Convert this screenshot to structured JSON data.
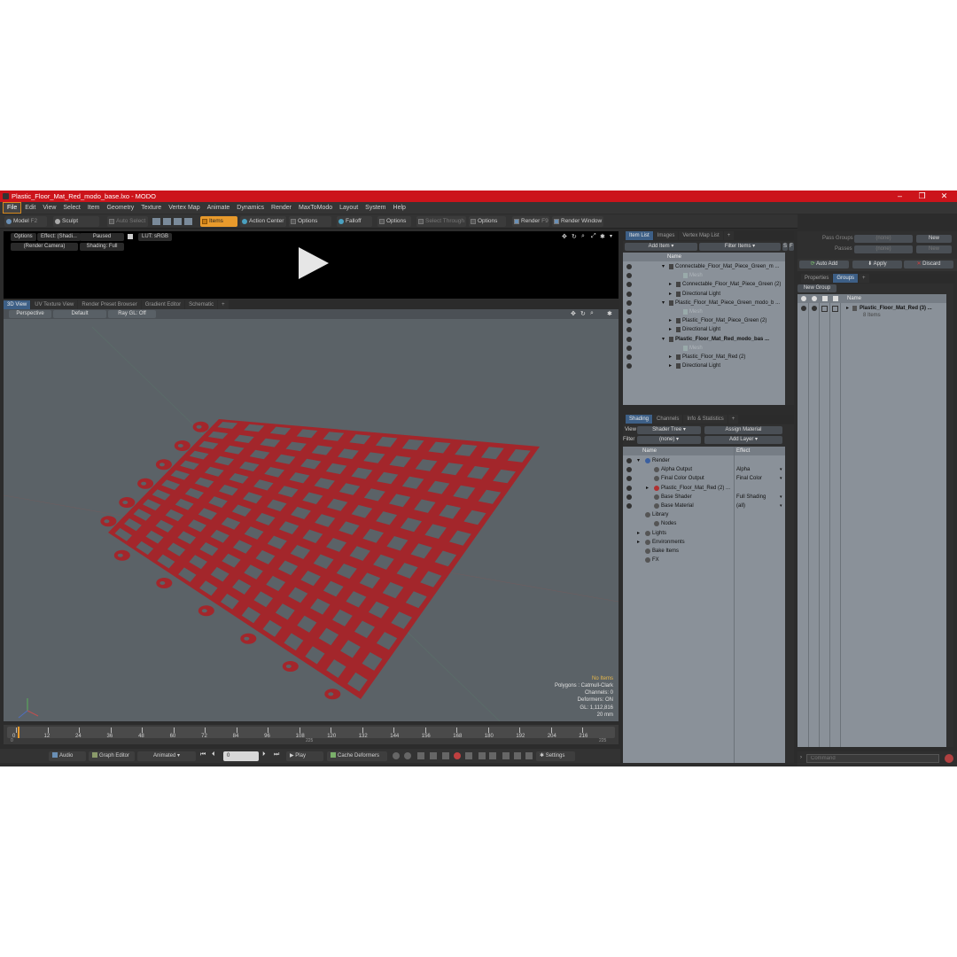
{
  "title": "Plastic_Floor_Mat_Red_modo_base.lxo - MODO",
  "window_controls": {
    "minimize": "–",
    "maximize": "❐",
    "close": "✕"
  },
  "menu": [
    "File",
    "Edit",
    "View",
    "Select",
    "Item",
    "Geometry",
    "Texture",
    "Vertex Map",
    "Animate",
    "Dynamics",
    "Render",
    "MaxToModo",
    "Layout",
    "System",
    "Help"
  ],
  "toolbar": {
    "model": "Model",
    "f2": "F2",
    "sculpt": "Sculpt",
    "auto_select": "Auto Select",
    "items": "Items",
    "action_center": "Action Center",
    "options1": "Options",
    "falloff": "Falloff",
    "options2": "Options",
    "select_through": "Select Through",
    "options3": "Options",
    "render": "Render",
    "f9": "F9",
    "render_window": "Render Window"
  },
  "preview": {
    "options": "Options",
    "effect": "Effect: (Shadi...",
    "paused": "Paused",
    "lut": "LUT: sRGB",
    "camera": "(Render Camera)",
    "shading": "Shading: Full"
  },
  "viewport_tabs": [
    "3D View",
    "UV Texture View",
    "Render Preset Browser",
    "Gradient Editor",
    "Schematic",
    "+"
  ],
  "viewport": {
    "perspective": "Perspective",
    "default": "Default",
    "raygl": "Ray GL: Off",
    "info": {
      "no_items": "No Items",
      "polygons": "Polygons : Catmull-Clark",
      "channels": "Channels: 0",
      "deformers": "Deformers: ON",
      "gl": "GL: 1,112,816",
      "units": "20 mm"
    }
  },
  "timeline": {
    "ticks": [
      "0",
      "12",
      "24",
      "36",
      "48",
      "60",
      "72",
      "84",
      "96",
      "108",
      "120",
      "132",
      "144",
      "156",
      "168",
      "180",
      "192",
      "204",
      "216"
    ],
    "sub_left": "0",
    "sub_mid": "225",
    "sub_right": "225"
  },
  "bottombar": {
    "audio": "Audio",
    "graph_editor": "Graph Editor",
    "animated": "Animated",
    "frame": "0",
    "play": "Play",
    "cache_deformers": "Cache Deformers",
    "settings": "Settings"
  },
  "item_list": {
    "tabs": [
      "Item List",
      "Images",
      "Vertex Map List",
      "+"
    ],
    "add_item": "Add Item",
    "filter_items": "Filter Items",
    "s": "S",
    "f": "F",
    "col_name": "Name",
    "rows": [
      {
        "label": "Connectable_Floor_Mat_Piece_Green_m ...",
        "indent": 0,
        "bold": false,
        "gray": false
      },
      {
        "label": "Mesh",
        "indent": 2,
        "bold": false,
        "gray": true
      },
      {
        "label": "Connectable_Floor_Mat_Piece_Green (2)",
        "indent": 1,
        "bold": false,
        "gray": false
      },
      {
        "label": "Directional Light",
        "indent": 1,
        "bold": false,
        "gray": false
      },
      {
        "label": "Plastic_Floor_Mat_Piece_Green_modo_b ...",
        "indent": 0,
        "bold": false,
        "gray": false
      },
      {
        "label": "Mesh",
        "indent": 2,
        "bold": false,
        "gray": true
      },
      {
        "label": "Plastic_Floor_Mat_Piece_Green (2)",
        "indent": 1,
        "bold": false,
        "gray": false
      },
      {
        "label": "Directional Light",
        "indent": 1,
        "bold": false,
        "gray": false
      },
      {
        "label": "Plastic_Floor_Mat_Red_modo_bas ...",
        "indent": 0,
        "bold": true,
        "gray": false
      },
      {
        "label": "Mesh",
        "indent": 2,
        "bold": false,
        "gray": true
      },
      {
        "label": "Plastic_Floor_Mat_Red (2)",
        "indent": 1,
        "bold": false,
        "gray": false
      },
      {
        "label": "Directional Light",
        "indent": 1,
        "bold": false,
        "gray": false
      }
    ]
  },
  "shading": {
    "tabs": [
      "Shading",
      "Channels",
      "Info & Statistics",
      "+"
    ],
    "view_label": "View",
    "view_value": "Shader Tree",
    "assign_material": "Assign Material",
    "filter_label": "Filter",
    "filter_value": "(none)",
    "add_layer": "Add Layer",
    "col_name": "Name",
    "col_effect": "Effect",
    "rows": [
      {
        "label": "Render",
        "effect": "",
        "indent": 0
      },
      {
        "label": "Alpha Output",
        "effect": "Alpha",
        "indent": 1
      },
      {
        "label": "Final Color Output",
        "effect": "Final Color",
        "indent": 1
      },
      {
        "label": "Plastic_Floor_Mat_Red (2) ...",
        "effect": "",
        "indent": 1
      },
      {
        "label": "Base Shader",
        "effect": "Full Shading",
        "indent": 1
      },
      {
        "label": "Base Material",
        "effect": "(all)",
        "indent": 1
      },
      {
        "label": "Library",
        "effect": "",
        "indent": 0
      },
      {
        "label": "Nodes",
        "effect": "",
        "indent": 1
      },
      {
        "label": "Lights",
        "effect": "",
        "indent": 0
      },
      {
        "label": "Environments",
        "effect": "",
        "indent": 0
      },
      {
        "label": "Bake Items",
        "effect": "",
        "indent": 0
      },
      {
        "label": "FX",
        "effect": "",
        "indent": 0
      }
    ]
  },
  "groups": {
    "pass_groups": "Pass Groups",
    "pass_groups_val": "(none)",
    "new1": "New",
    "passes": "Passes",
    "passes_val": "(none)",
    "new2": "New",
    "auto_add": "Auto Add",
    "apply": "Apply",
    "discard": "Discard",
    "tabs": [
      "Properties",
      "Groups",
      "+"
    ],
    "new_group": "New Group",
    "col_name": "Name",
    "group_name": "Plastic_Floor_Mat_Red (3) ...",
    "group_items": "8 Items",
    "command_placeholder": "Command"
  },
  "colors": {
    "accent": "#cc141b",
    "highlight": "#e89a2c",
    "mat_red": "#a3262b",
    "viewport": "#5b6267"
  }
}
